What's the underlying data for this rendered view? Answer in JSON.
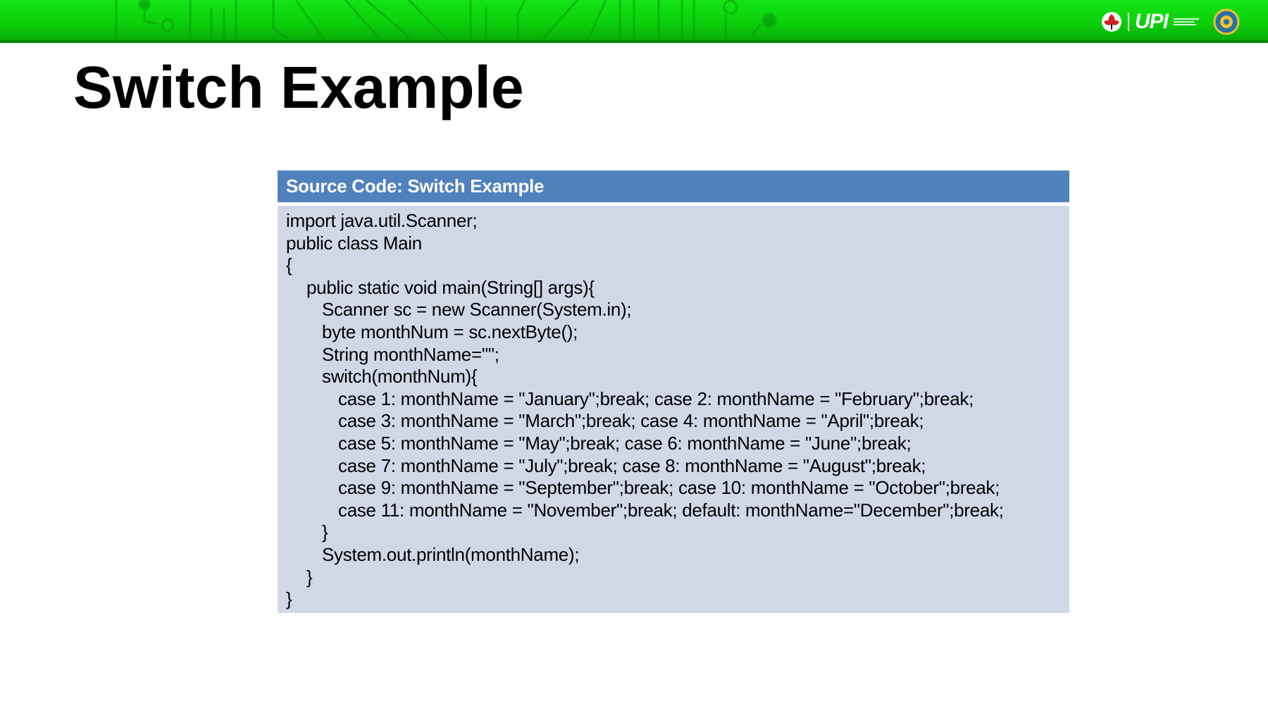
{
  "slide": {
    "title": "Switch Example",
    "brand": {
      "name": "UPI"
    }
  },
  "code_panel": {
    "header": "Source Code: Switch Example",
    "lines": [
      {
        "indent": 0,
        "text": "import java.util.Scanner;"
      },
      {
        "indent": 0,
        "text": "public class Main"
      },
      {
        "indent": 0,
        "text": "{"
      },
      {
        "indent": 1,
        "text": "public static void main(String[] args){"
      },
      {
        "indent": 2,
        "text": "Scanner sc = new Scanner(System.in);"
      },
      {
        "indent": 2,
        "text": "byte monthNum = sc.nextByte();"
      },
      {
        "indent": 2,
        "text": "String monthName=\"\";"
      },
      {
        "indent": 2,
        "text": "switch(monthNum){"
      },
      {
        "indent": 3,
        "text": "case 1: monthName = \"January\";break; case 2: monthName = \"February\";break;"
      },
      {
        "indent": 3,
        "text": "case 3: monthName = \"March\";break; case 4: monthName = \"April\";break;"
      },
      {
        "indent": 3,
        "text": "case 5: monthName = \"May\";break; case 6: monthName = \"June\";break;"
      },
      {
        "indent": 3,
        "text": "case 7: monthName = \"July\";break; case 8: monthName = \"August\";break;"
      },
      {
        "indent": 3,
        "text": "case 9: monthName = \"September\";break; case 10: monthName = \"October\";break;"
      },
      {
        "indent": 3,
        "text": "case 11: monthName = \"November\";break; default: monthName=\"December\";break;"
      },
      {
        "indent": 2,
        "text": "}"
      },
      {
        "indent": 2,
        "text": "System.out.println(monthName);"
      },
      {
        "indent": 1,
        "text": "}"
      },
      {
        "indent": 0,
        "text": "}"
      }
    ]
  },
  "colors": {
    "banner_green": "#0bcf0b",
    "header_blue": "#4f81bd",
    "code_background": "#d0d8e8"
  },
  "icons": [
    "upi-flower-logo-icon",
    "university-seal-icon",
    "circuit-pattern-decoration"
  ]
}
